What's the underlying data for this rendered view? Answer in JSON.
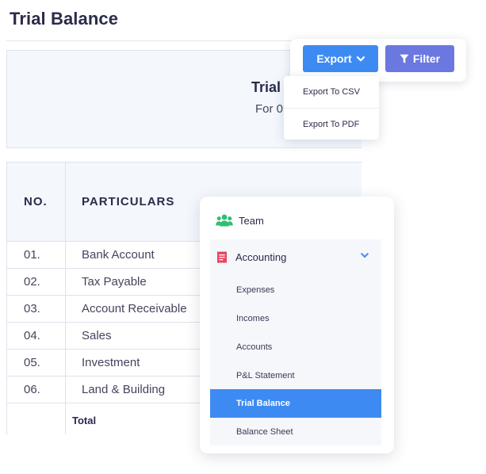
{
  "page": {
    "title": "Trial Balance"
  },
  "report": {
    "title": "Trial",
    "subtitle": "For 0"
  },
  "table": {
    "headers": {
      "no": "NO.",
      "particulars": "PARTICULARS"
    },
    "rows": [
      {
        "no": "01.",
        "particular": "Bank Account"
      },
      {
        "no": "02.",
        "particular": "Tax Payable"
      },
      {
        "no": "03.",
        "particular": "Account Receivable"
      },
      {
        "no": "04.",
        "particular": "Sales"
      },
      {
        "no": "05.",
        "particular": "Investment"
      },
      {
        "no": "06.",
        "particular": "Land & Building"
      }
    ],
    "total_label": "Total"
  },
  "toolbar": {
    "export_label": "Export",
    "filter_label": "Filter"
  },
  "export_menu": {
    "items": [
      "Export To CSV",
      "Export To PDF"
    ]
  },
  "nav": {
    "team_label": "Team",
    "accounting_label": "Accounting",
    "sub_items": [
      "Expenses",
      "Incomes",
      "Accounts",
      "P&L Statement",
      "Trial Balance",
      "Balance Sheet"
    ],
    "active_item": "Trial Balance"
  },
  "icons": {
    "team": "team-icon",
    "accounting": "receipt-icon",
    "chevron": "chevron-down-icon",
    "filter": "funnel-icon"
  },
  "colors": {
    "primary": "#3d8bf2",
    "filter_button": "#6a78e0",
    "team_icon": "#2fbf71",
    "accounting_icon": "#e8455f",
    "heading_text": "#2b2b4a"
  }
}
